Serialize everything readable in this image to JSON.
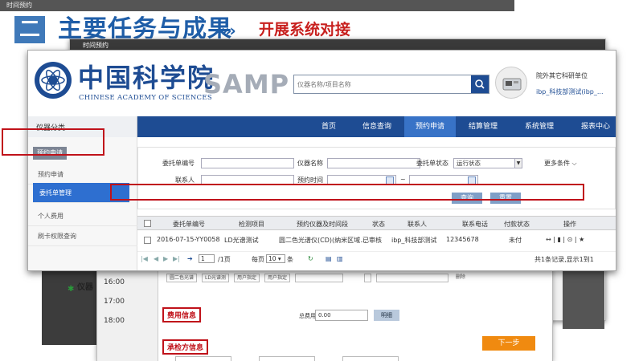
{
  "slide": {
    "number": "二",
    "title": "主要任务与成果",
    "arrows": "›››",
    "subtitle": "开展系统对接"
  },
  "background": {
    "back_window_title": "时间预约",
    "mid_window_title": "时间预约",
    "times": [
      "16:00",
      "17:00",
      "18:00"
    ],
    "row_label": "仪器",
    "selects": [
      "圆二色光谱",
      "LD光谱测",
      "用户指定",
      "用户指定"
    ],
    "delete_label": "删除",
    "fee_section": "费用信息",
    "fee_total_label": "总费用",
    "fee_value": "0.00",
    "fee_button": "明细",
    "tester_section": "承检方信息",
    "next_button": "下一步"
  },
  "header": {
    "cas_cn": "中国科学院",
    "cas_en": "CHINESE ACADEMY OF SCIENCES",
    "samp": "SAMP",
    "search_placeholder": "仪器名称/项目名称",
    "user_org": "院外其它科研单位",
    "user_name": "ibp_科技部测试(ibp_..."
  },
  "nav": {
    "category": "仪器分类",
    "items": [
      "首页",
      "信息查询",
      "预约申请",
      "结算管理",
      "系统管理",
      "报表中心"
    ],
    "active": "预约申请"
  },
  "sidebar": {
    "header": "预约申请",
    "items": [
      "预约申请",
      "委托单管理",
      "个人费用",
      "刷卡权限查询"
    ],
    "active": "委托单管理"
  },
  "filter": {
    "order_no_label": "委托单编号",
    "instrument_label": "仪器名称",
    "status_label": "委托单状态",
    "status_value": "运行状态",
    "more_label": "更多条件",
    "contact_label": "联系人",
    "time_label": "预约时间",
    "time_sep": "~",
    "query_button": "查询",
    "reset_button": "重置"
  },
  "table": {
    "columns": [
      "委托单编号",
      "检测项目",
      "预约仪器及时间段",
      "状态",
      "联系人",
      "联系电话",
      "付款状态",
      "操作"
    ],
    "rows": [
      {
        "order_no": "2016-07-15-YY0058",
        "item": "LD光谱测试",
        "instrument": "圆二色光谱仪(CD)(纳米区域...",
        "status": "已审核",
        "contact": "ibp_科技部测试",
        "phone": "12345678",
        "pay_status": "未付",
        "ops": "↔ | ▮ | ⊙ | ★"
      }
    ]
  },
  "pager": {
    "page_value": "1",
    "total_pages": "/1页",
    "per_page_label": "每页",
    "per_page_value": "10",
    "per_page_unit": "条",
    "summary": "共1条记录,显示1到1"
  }
}
